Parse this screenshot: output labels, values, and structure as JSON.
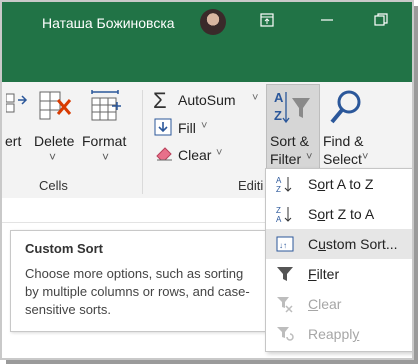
{
  "titlebar": {
    "user_name": "Наташа Божиновска",
    "icons": [
      "ribbon-display-icon",
      "minimize-icon",
      "restore-icon"
    ]
  },
  "ribbon": {
    "cells_group": {
      "label": "Cells",
      "insert_label": "ert",
      "delete_label": "Delete",
      "format_label": "Format",
      "delete_arrow": "˅",
      "format_arrow": "˅"
    },
    "editing_group": {
      "label": "Editi",
      "autosum_label": "AutoSum",
      "autosum_arrow": "˅",
      "fill_label": "Fill",
      "fill_arrow": "˅",
      "clear_label": "Clear",
      "clear_arrow": "˅",
      "sort_filter_line1": "Sort &",
      "sort_filter_line2": "Filter",
      "sort_filter_arrow": "˅",
      "find_select_line1": "Find &",
      "find_select_line2": "Select",
      "find_select_arrow": "˅"
    }
  },
  "tooltip": {
    "title": "Custom Sort",
    "body": "Choose more options, such as sorting by multiple columns or rows, and case-sensitive sorts."
  },
  "menu": {
    "items": [
      {
        "pre": "S",
        "u": "o",
        "post": "rt A to Z",
        "icon": "sort-a-to-z-icon",
        "enabled": true
      },
      {
        "pre": "S",
        "u": "o",
        "post": "rt Z to A",
        "icon": "sort-z-to-a-icon",
        "enabled": true
      },
      {
        "pre": "C",
        "u": "u",
        "post": "stom Sort...",
        "icon": "custom-sort-icon",
        "enabled": true
      },
      {
        "pre": "",
        "u": "F",
        "post": "ilter",
        "icon": "filter-icon",
        "enabled": true
      },
      {
        "pre": "",
        "u": "C",
        "post": "lear",
        "icon": "clear-filter-icon",
        "enabled": false
      },
      {
        "pre": "Reappl",
        "u": "y",
        "post": "",
        "icon": "reapply-icon",
        "enabled": false
      }
    ]
  },
  "colors": {
    "excel_green": "#217346",
    "ribbon_bg": "#f3f3f3",
    "accent_blue": "#2b579a",
    "delete_red": "#d83b01"
  }
}
